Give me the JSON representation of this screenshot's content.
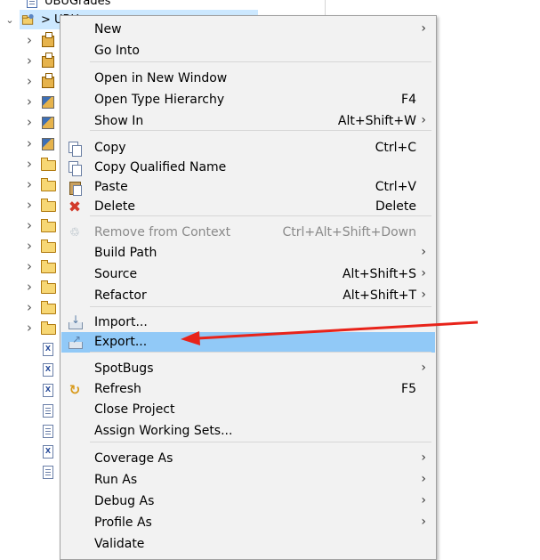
{
  "tree": {
    "top_item_label": "UBUGrades",
    "project_label": "> UBU",
    "rows": [
      {
        "icon": "package-icon"
      },
      {
        "icon": "package-icon"
      },
      {
        "icon": "package-icon"
      },
      {
        "icon": "jar-icon"
      },
      {
        "icon": "jar-icon"
      },
      {
        "icon": "jar-icon"
      },
      {
        "icon": "folder-icon"
      },
      {
        "icon": "folder-icon"
      },
      {
        "icon": "folder-icon"
      },
      {
        "icon": "folder-icon"
      },
      {
        "icon": "folder-icon"
      },
      {
        "icon": "folder-icon"
      },
      {
        "icon": "folder-icon"
      },
      {
        "icon": "folder-icon"
      },
      {
        "icon": "folder-icon"
      },
      {
        "icon": "xml-file-icon"
      },
      {
        "icon": "xml-file-icon"
      },
      {
        "icon": "xml-file-icon"
      },
      {
        "icon": "file-icon"
      },
      {
        "icon": "file-icon"
      },
      {
        "icon": "xml-file-icon"
      },
      {
        "icon": "file-icon"
      }
    ]
  },
  "menu": {
    "items": [
      {
        "label": "New",
        "shortcut": "",
        "submenu": true
      },
      {
        "label": "Go Into",
        "shortcut": "",
        "submenu": false
      },
      {
        "label": "Open in New Window",
        "shortcut": "",
        "submenu": false
      },
      {
        "label": "Open Type Hierarchy",
        "shortcut": "F4",
        "submenu": false
      },
      {
        "label": "Show In",
        "shortcut": "Alt+Shift+W",
        "submenu": true
      },
      {
        "label": "Copy",
        "shortcut": "Ctrl+C",
        "submenu": false,
        "icon": "copy-icon"
      },
      {
        "label": "Copy Qualified Name",
        "shortcut": "",
        "submenu": false,
        "icon": "copy-qualified-name-icon"
      },
      {
        "label": "Paste",
        "shortcut": "Ctrl+V",
        "submenu": false,
        "icon": "paste-icon"
      },
      {
        "label": "Delete",
        "shortcut": "Delete",
        "submenu": false,
        "icon": "delete-icon"
      },
      {
        "label": "Remove from Context",
        "shortcut": "Ctrl+Alt+Shift+Down",
        "submenu": false,
        "icon": "remove-from-context-icon",
        "disabled": true
      },
      {
        "label": "Build Path",
        "shortcut": "",
        "submenu": true
      },
      {
        "label": "Source",
        "shortcut": "Alt+Shift+S",
        "submenu": true
      },
      {
        "label": "Refactor",
        "shortcut": "Alt+Shift+T",
        "submenu": true
      },
      {
        "label": "Import...",
        "shortcut": "",
        "submenu": false,
        "icon": "import-icon"
      },
      {
        "label": "Export...",
        "shortcut": "",
        "submenu": false,
        "icon": "export-icon",
        "highlighted": true
      },
      {
        "label": "SpotBugs",
        "shortcut": "",
        "submenu": true
      },
      {
        "label": "Refresh",
        "shortcut": "F5",
        "submenu": false,
        "icon": "refresh-icon"
      },
      {
        "label": "Close Project",
        "shortcut": "",
        "submenu": false
      },
      {
        "label": "Assign Working Sets...",
        "shortcut": "",
        "submenu": false
      },
      {
        "label": "Coverage As",
        "shortcut": "",
        "submenu": true
      },
      {
        "label": "Run As",
        "shortcut": "",
        "submenu": true
      },
      {
        "label": "Debug As",
        "shortcut": "",
        "submenu": true
      },
      {
        "label": "Profile As",
        "shortcut": "",
        "submenu": true
      },
      {
        "label": "Validate",
        "shortcut": "",
        "submenu": false
      }
    ]
  },
  "colors": {
    "highlight": "#91c9f7",
    "menu_background": "#f2f2f2",
    "annotation_arrow": "#e8231a"
  }
}
